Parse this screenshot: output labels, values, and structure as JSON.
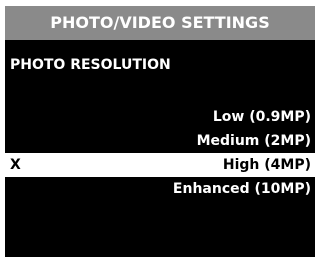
{
  "header": {
    "title": "PHOTO/VIDEO SETTINGS"
  },
  "section": {
    "title": "PHOTO RESOLUTION"
  },
  "options": [
    {
      "label": "Low (0.9MP)",
      "mark": ""
    },
    {
      "label": "Medium (2MP)",
      "mark": ""
    },
    {
      "label": "High (4MP)",
      "mark": "X"
    },
    {
      "label": "Enhanced (10MP)",
      "mark": ""
    }
  ],
  "colors": {
    "background": "#000000",
    "header_background": "#8a8a8a",
    "selected_background": "#ffffff",
    "text": "#ffffff",
    "selected_text": "#000000"
  }
}
